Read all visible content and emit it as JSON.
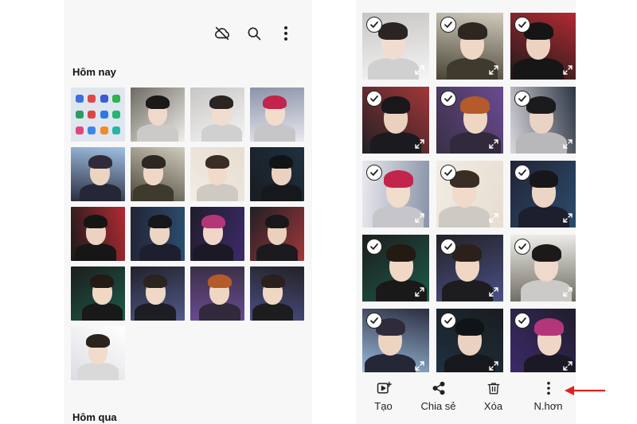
{
  "left": {
    "section_today": "Hôm nay",
    "section_yesterday": "Hôm qua",
    "icons": [
      "cloud-off-icon",
      "search-icon",
      "more-vert-icon"
    ],
    "thumbs_count": 17
  },
  "right": {
    "thumbs_count": 15,
    "bar": [
      {
        "label": "Tạo",
        "icon": "create-icon"
      },
      {
        "label": "Chia sẻ",
        "icon": "share-icon"
      },
      {
        "label": "Xóa",
        "icon": "trash-icon"
      },
      {
        "label": "N.hơn",
        "icon": "more-vert-icon"
      }
    ]
  },
  "colors": {
    "arrow": "#e02020"
  }
}
